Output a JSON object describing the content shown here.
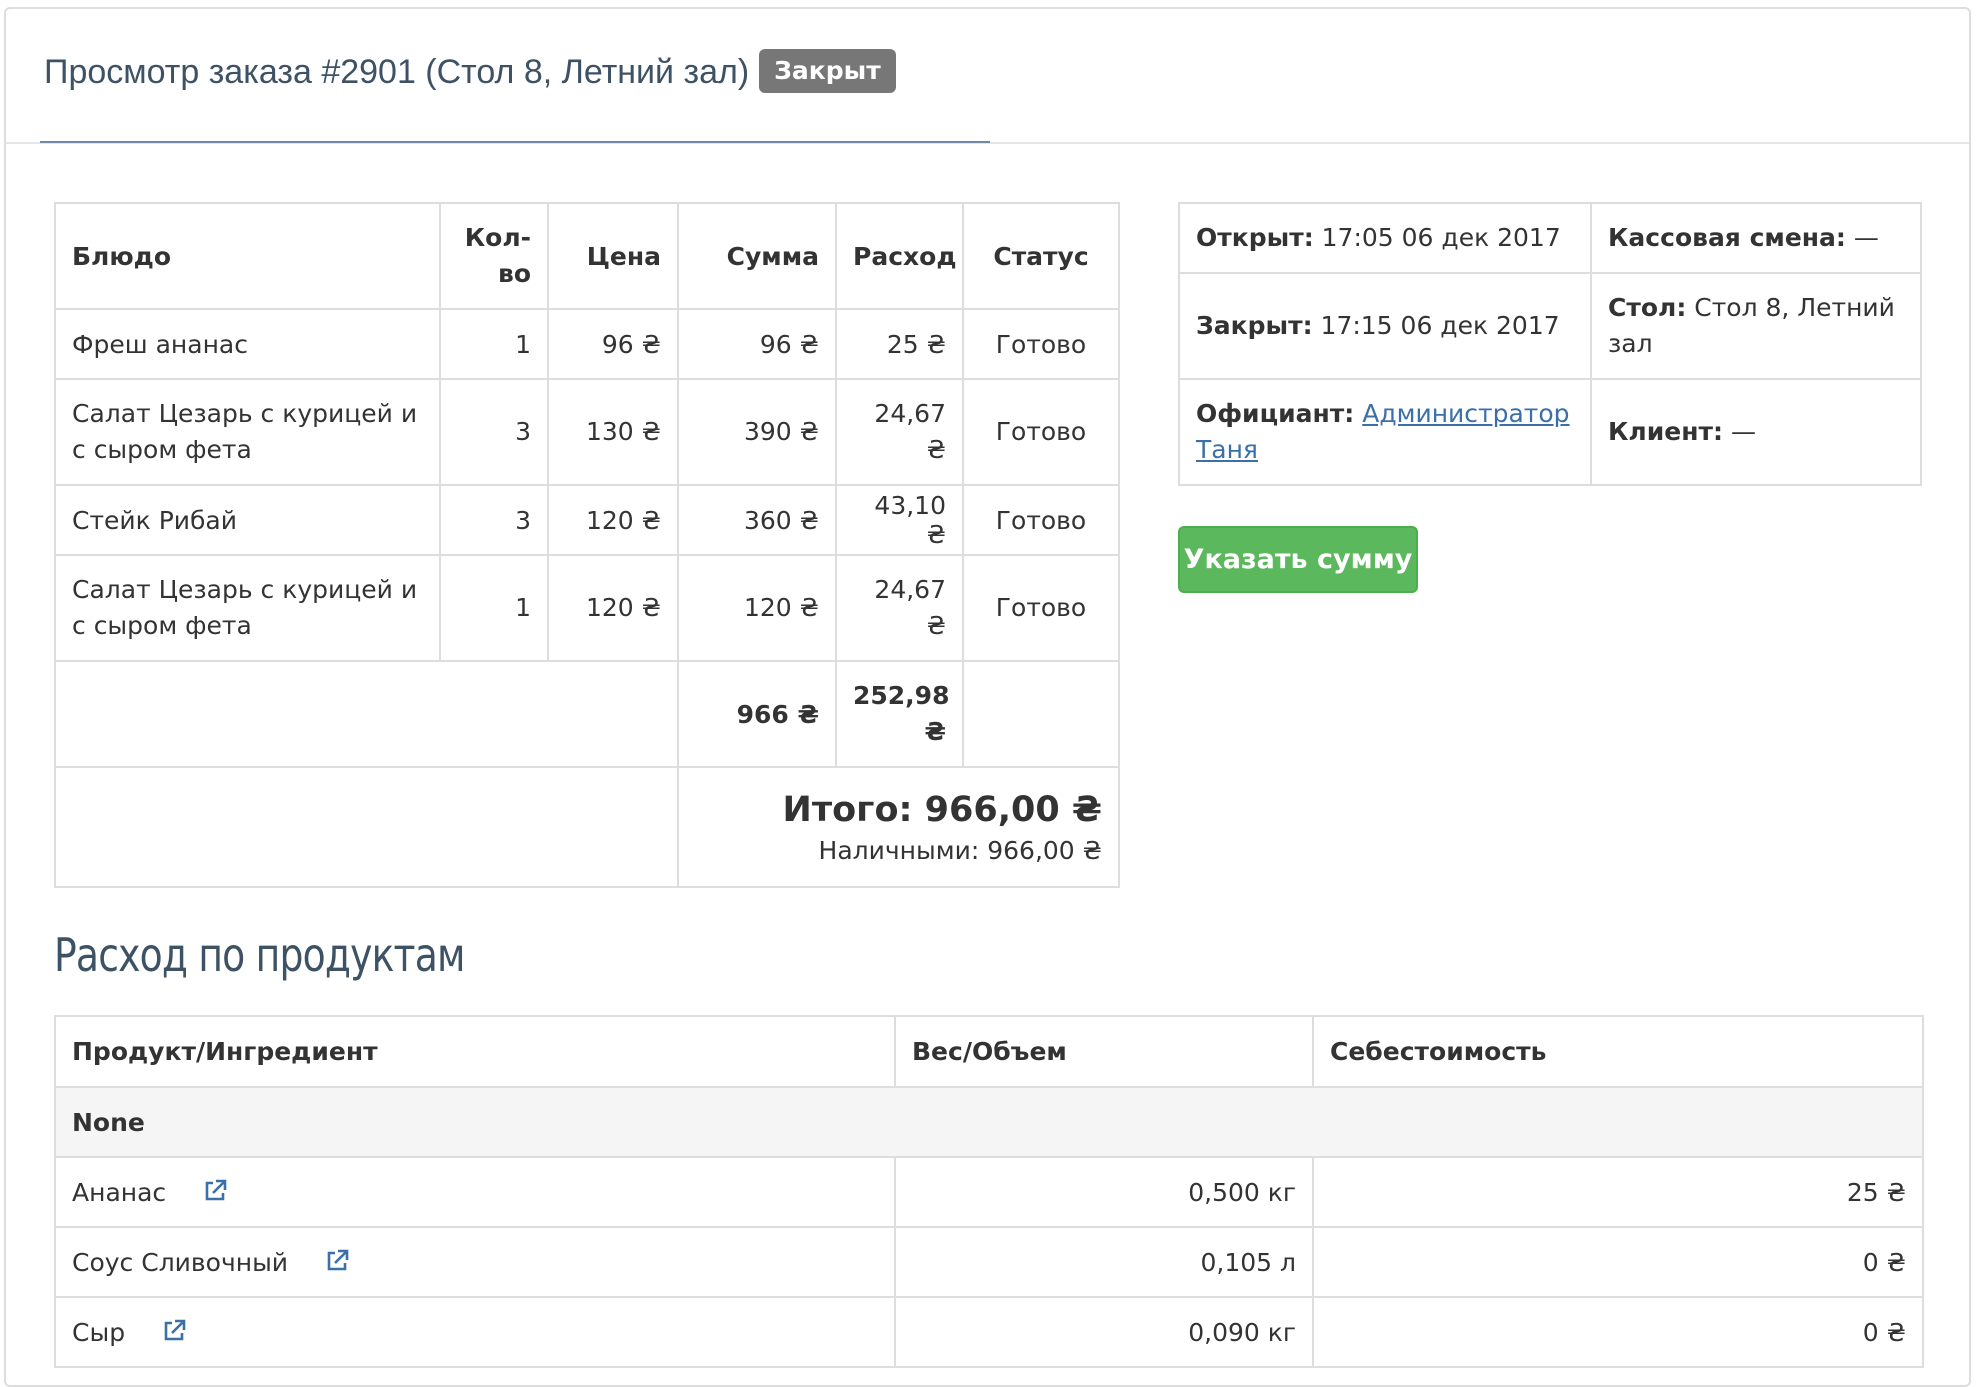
{
  "header": {
    "title": "Просмотр заказа #2901 (Стол 8, Летний зал)",
    "status_badge": "Закрыт"
  },
  "order_table": {
    "headers": {
      "dish": "Блюдо",
      "qty_line1": "Кол-",
      "qty_line2": "во",
      "price": "Цена",
      "sum": "Сумма",
      "expense": "Расход",
      "status": "Статус"
    },
    "rows": [
      {
        "dish": "Фреш ананас",
        "qty": "1",
        "price": "96 ₴",
        "sum": "96 ₴",
        "expense": "25 ₴",
        "status": "Готово"
      },
      {
        "dish": "Салат Цезарь с курицей и с сыром фета",
        "qty": "3",
        "price": "130 ₴",
        "sum": "390 ₴",
        "expense": "24,67 ₴",
        "status": "Готово"
      },
      {
        "dish": "Стейк Рибай",
        "qty": "3",
        "price": "120 ₴",
        "sum": "360 ₴",
        "expense": "43,10 ₴",
        "status": "Готово"
      },
      {
        "dish": "Салат Цезарь с курицей и с сыром фета",
        "qty": "1",
        "price": "120 ₴",
        "sum": "120 ₴",
        "expense": "24,67 ₴",
        "status": "Готово"
      }
    ],
    "sum_total": "966 ₴",
    "expense_total": "252,98 ₴",
    "grand_total": "Итого: 966,00 ₴",
    "cash_total": "Наличными: 966,00 ₴"
  },
  "info": {
    "opened_label": "Открыт:",
    "opened_value": "17:05 06 дек 2017",
    "shift_label": "Кассовая смена:",
    "shift_value": "—",
    "closed_label": "Закрыт:",
    "closed_value": "17:15 06 дек 2017",
    "table_label": "Стол:",
    "table_value": "Стол 8, Летний зал",
    "waiter_label": "Официант:",
    "waiter_value": "Администратор Таня",
    "client_label": "Клиент:",
    "client_value": "—"
  },
  "set_amount_button": "Указать сумму",
  "products_section": {
    "title": "Расход по продуктам",
    "headers": {
      "product": "Продукт/Ингредиент",
      "weight": "Вес/Объем",
      "cost": "Себестоимость"
    },
    "group_name": "None",
    "rows": [
      {
        "name": "Ананас",
        "weight": "0,500 кг",
        "cost": "25 ₴"
      },
      {
        "name": "Соус Сливочный",
        "weight": "0,105 л",
        "cost": "0 ₴"
      },
      {
        "name": "Сыр",
        "weight": "0,090 кг",
        "cost": "0 ₴"
      }
    ]
  },
  "colors": {
    "title": "#3e5266",
    "badge": "#777777",
    "button_green": "#5cb85c",
    "link": "#3b6fa9",
    "border": "#dddddd"
  },
  "icons": {
    "external_link": "external-link-icon"
  }
}
